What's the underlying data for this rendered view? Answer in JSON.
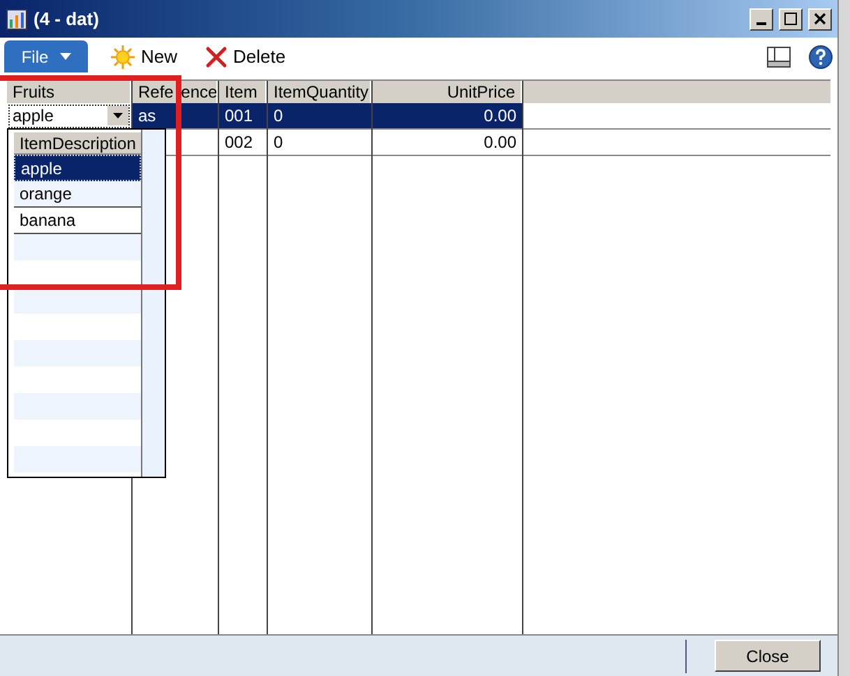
{
  "window": {
    "title": "(4 - dat)"
  },
  "toolbar": {
    "file_menu": "File",
    "buttons": [
      {
        "kind": "new",
        "label": "New"
      },
      {
        "kind": "delete",
        "label": "Delete"
      }
    ]
  },
  "grid": {
    "columns": [
      {
        "label": "Fruits"
      },
      {
        "label": "Refe ence"
      },
      {
        "label": "Item"
      },
      {
        "label": "ItemQuantity"
      },
      {
        "label": "UnitPrice"
      }
    ],
    "rows": [
      {
        "selected": true,
        "cells": [
          "apple",
          "as",
          "001",
          "0",
          "0.00"
        ]
      },
      {
        "selected": false,
        "cells": [
          null,
          null,
          "002",
          "0",
          "0.00"
        ]
      }
    ]
  },
  "dropdown": {
    "header": "ItemDescription",
    "items": [
      {
        "label": "apple",
        "selected": true
      },
      {
        "label": "orange",
        "selected": false
      },
      {
        "label": "banana",
        "selected": false
      }
    ]
  },
  "footer": {
    "close_button": "Close"
  }
}
